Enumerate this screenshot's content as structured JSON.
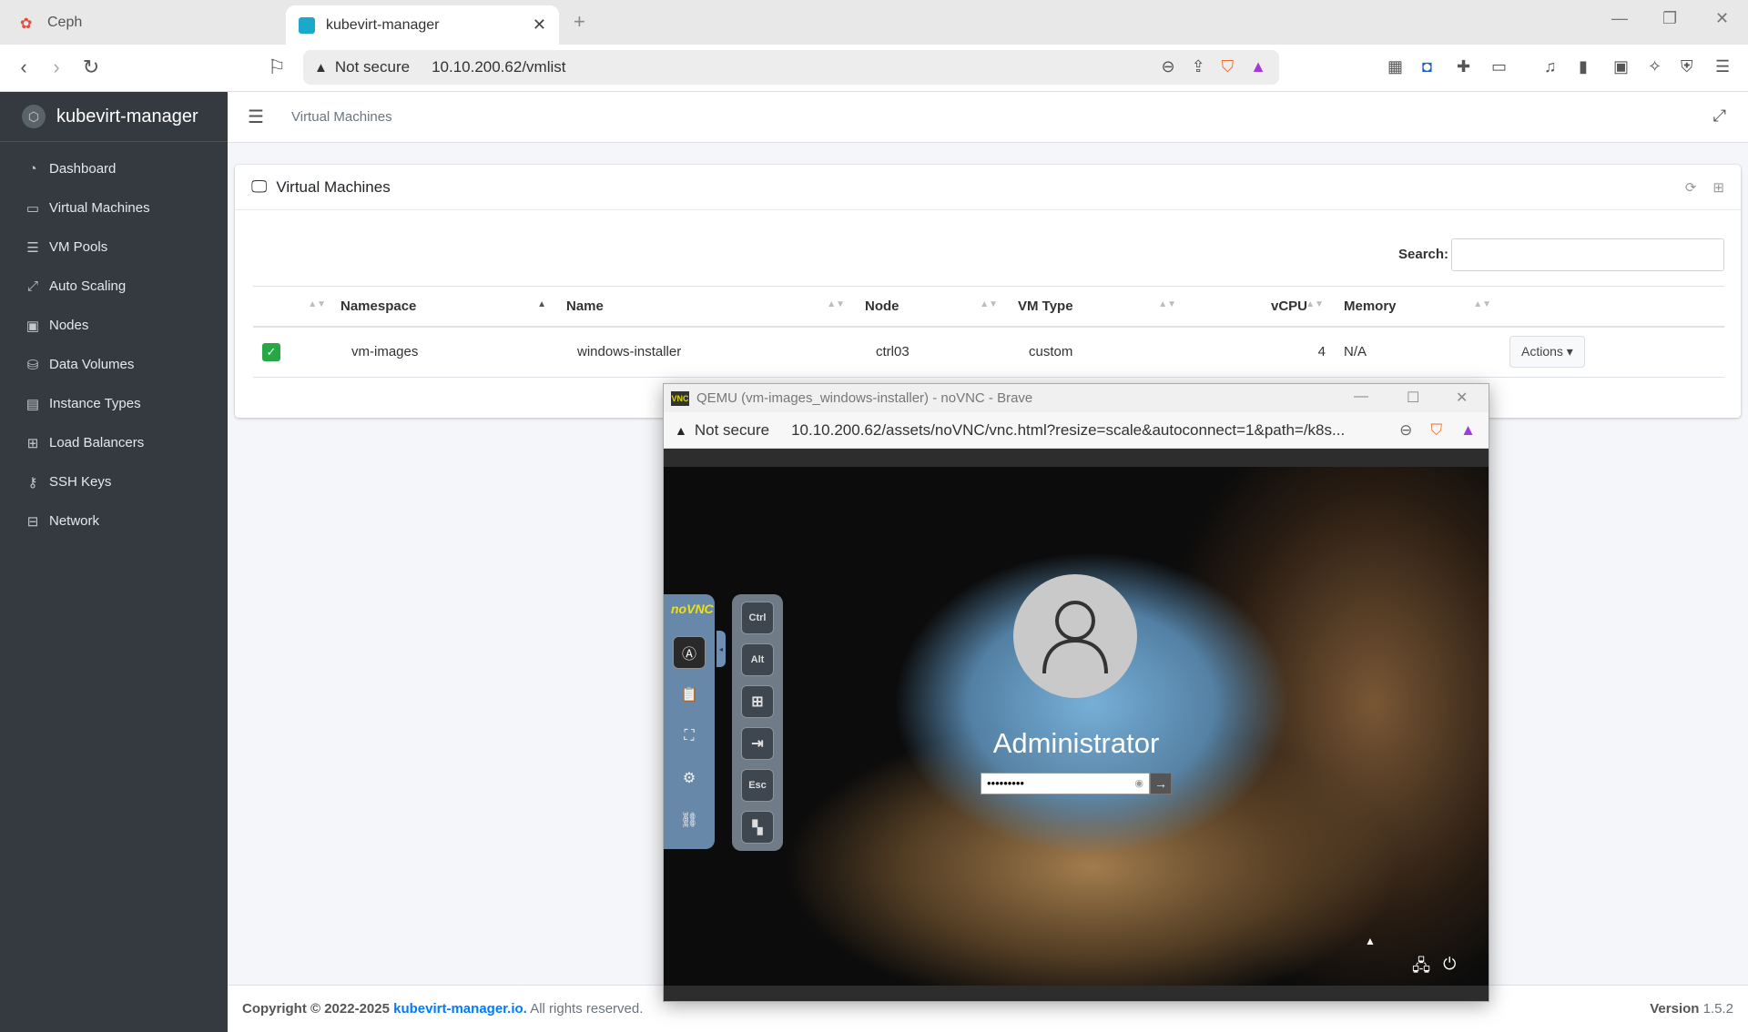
{
  "browser": {
    "tabs": [
      {
        "label": "Ceph",
        "active": false
      },
      {
        "label": "kubevirt-manager",
        "active": true
      }
    ],
    "address": {
      "security": "Not secure",
      "url": "10.10.200.62/vmlist"
    },
    "window_controls": [
      "minimize",
      "restore",
      "close"
    ]
  },
  "app": {
    "brand": "kubevirt-manager",
    "sidebar": {
      "items": [
        {
          "label": "Dashboard",
          "icon": "gauge-icon"
        },
        {
          "label": "Virtual Machines",
          "icon": "desktop-icon"
        },
        {
          "label": "VM Pools",
          "icon": "server-icon"
        },
        {
          "label": "Auto Scaling",
          "icon": "arrows-expand-icon"
        },
        {
          "label": "Nodes",
          "icon": "box-icon"
        },
        {
          "label": "Data Volumes",
          "icon": "database-icon"
        },
        {
          "label": "Instance Types",
          "icon": "list-icon"
        },
        {
          "label": "Load Balancers",
          "icon": "sitemap-icon"
        },
        {
          "label": "SSH Keys",
          "icon": "key-icon"
        },
        {
          "label": "Network",
          "icon": "network-icon"
        }
      ]
    },
    "breadcrumb": "Virtual Machines",
    "card": {
      "title": "Virtual Machines",
      "search_label": "Search:",
      "search_value": "",
      "columns": [
        "Namespace",
        "Name",
        "Node",
        "VM Type",
        "vCPU",
        "Memory"
      ],
      "rows": [
        {
          "status": "running",
          "namespace": "vm-images",
          "name": "windows-installer",
          "node": "ctrl03",
          "vm_type": "custom",
          "vcpu": "4",
          "memory": "N/A",
          "action": "Actions"
        }
      ]
    },
    "footer": {
      "copyright_prefix": "Copyright © 2022-2025",
      "link": "kubevirt-manager.io.",
      "suffix": "All rights reserved.",
      "version_label": "Version",
      "version": "1.5.2"
    }
  },
  "vnc_window": {
    "title": "QEMU (vm-images_windows-installer) - noVNC - Brave",
    "security": "Not secure",
    "url": "10.10.200.62/assets/noVNC/vnc.html?resize=scale&autoconnect=1&path=/k8s...",
    "login": {
      "user": "Administrator",
      "password_mask": "•••••••••"
    },
    "novnc_logo": "noVNC",
    "keys": [
      "Ctrl",
      "Alt",
      "Win",
      "Tab",
      "Esc",
      "Ctrl+Alt+Del"
    ]
  },
  "colors": {
    "sidebar_bg": "#343a40",
    "link": "#007bff",
    "status_ok": "#28a745"
  }
}
